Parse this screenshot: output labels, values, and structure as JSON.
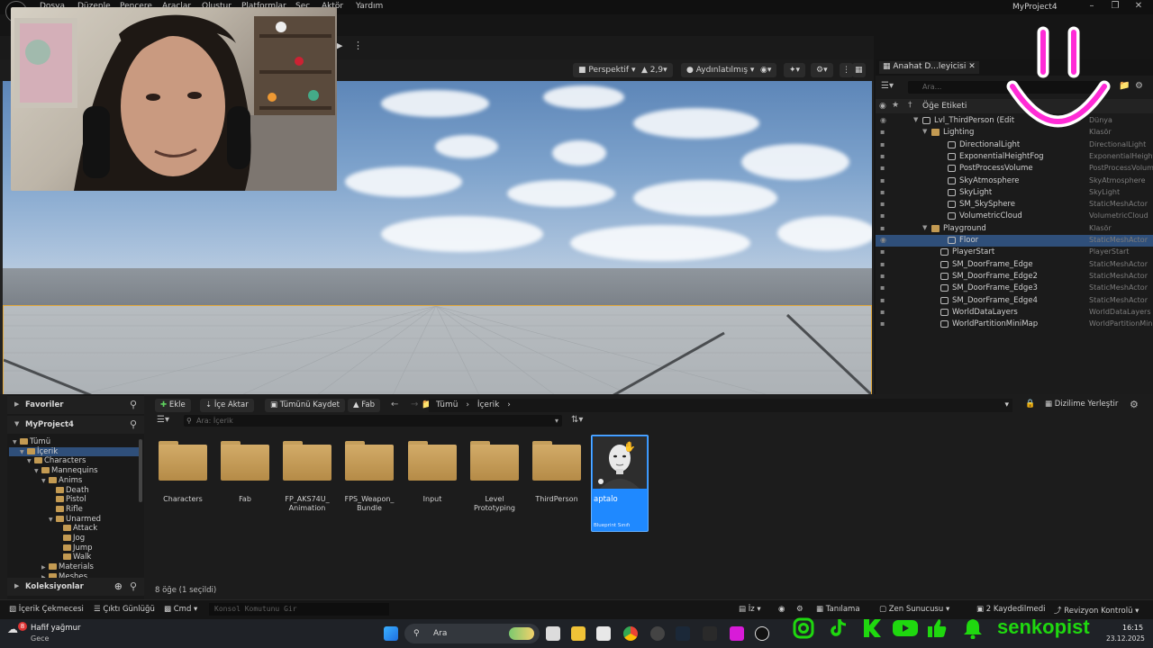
{
  "menu": {
    "items": [
      "Dosya",
      "Düzenle",
      "Pencere",
      "Araçlar",
      "Oluştur",
      "Platformlar",
      "Seç",
      "Aktör",
      "Yardım"
    ],
    "project_name": "MyProject4"
  },
  "viewport": {
    "perspective_label": "Perspektif",
    "fov_value": "2,9",
    "lighting_label": "Aydınlatılmış"
  },
  "outliner": {
    "tab_label": "Anahat D...leyicisi",
    "search_placeholder": "Ara",
    "header_label": "Öğe Etiketi",
    "rows": [
      {
        "label": "Lvl_ThirdPerson (Edit",
        "type": "Dünya"
      },
      {
        "label": "Lighting",
        "type": "Klasör"
      },
      {
        "label": "DirectionalLight",
        "type": "DirectionalLight"
      },
      {
        "label": "ExponentialHeightFog",
        "type": "ExponentialHeight"
      },
      {
        "label": "PostProcessVolume",
        "type": "PostProcessVolum"
      },
      {
        "label": "SkyAtmosphere",
        "type": "SkyAtmosphere"
      },
      {
        "label": "SkyLight",
        "type": "SkyLight"
      },
      {
        "label": "SM_SkySphere",
        "type": "StaticMeshActor"
      },
      {
        "label": "VolumetricCloud",
        "type": "VolumetricCloud"
      },
      {
        "label": "Playground",
        "type": "Klasör"
      },
      {
        "label": "Floor",
        "type": "StaticMeshActor"
      },
      {
        "label": "PlayerStart",
        "type": "PlayerStart"
      },
      {
        "label": "SM_DoorFrame_Edge",
        "type": "StaticMeshActor"
      },
      {
        "label": "SM_DoorFrame_Edge2",
        "type": "StaticMeshActor"
      },
      {
        "label": "SM_DoorFrame_Edge3",
        "type": "StaticMeshActor"
      },
      {
        "label": "SM_DoorFrame_Edge4",
        "type": "StaticMeshActor"
      },
      {
        "label": "WorldDataLayers",
        "type": "WorldDataLayers"
      },
      {
        "label": "WorldPartitionMiniMap",
        "type": "WorldPartitionMin"
      }
    ]
  },
  "content_browser": {
    "favorites_label": "Favoriler",
    "project_label": "MyProject4",
    "collections_label": "Koleksiyonlar",
    "tree": [
      "Tümü",
      "İçerik",
      "Characters",
      "Mannequins",
      "Anims",
      "Death",
      "Pistol",
      "Rifle",
      "Unarmed",
      "Attack",
      "Jog",
      "Jump",
      "Walk",
      "Materials",
      "Meshes"
    ],
    "toolbar": {
      "add_label": "Ekle",
      "import_label": "İçe Aktar",
      "save_all_label": "Tümünü Kaydet",
      "fab_label": "Fab",
      "path_root": "Tümü",
      "path_current": "İçerik",
      "dock_label": "Dizilime Yerleştir"
    },
    "search_placeholder": "Ara: İçerik",
    "folders": [
      {
        "name": "Characters"
      },
      {
        "name": "Fab"
      },
      {
        "name": "FP_AKS74U_ Animation"
      },
      {
        "name": "FPS_Weapon_ Bundle"
      },
      {
        "name": "Input"
      },
      {
        "name": "Level Prototyping"
      },
      {
        "name": "ThirdPerson"
      }
    ],
    "selected_asset": {
      "name": "aptalo",
      "type": "Blueprint Sınıfı"
    },
    "item_count": "8 öğe (1 seçildi)"
  },
  "statusbar": {
    "drawer_label": "İçerik Çekmecesi",
    "output_log_label": "Çıktı Günlüğü",
    "cmd_label": "Cmd",
    "console_placeholder": "Konsol Komutunu Gir",
    "trace_label": "İz",
    "derived_label": "Tanılama",
    "zen_label": "Zen Sunucusu",
    "saved_label": "2 Kaydedilmedi",
    "revision_label": "Revizyon Kontrolü"
  },
  "taskbar": {
    "weather_text": "Hafif yağmur",
    "weather_sub": "Gece",
    "weather_badge": "8",
    "search_label": "Ara",
    "time": "16:15",
    "date": "23.12.2025",
    "overlay_handle": "senkopist"
  },
  "colors": {
    "accent_blue": "#1f89ff",
    "folder": "#c39a52",
    "selection": "#2f4f7a",
    "overlay_green": "#1fd80f",
    "smiley_pink": "#ff2bd6"
  }
}
